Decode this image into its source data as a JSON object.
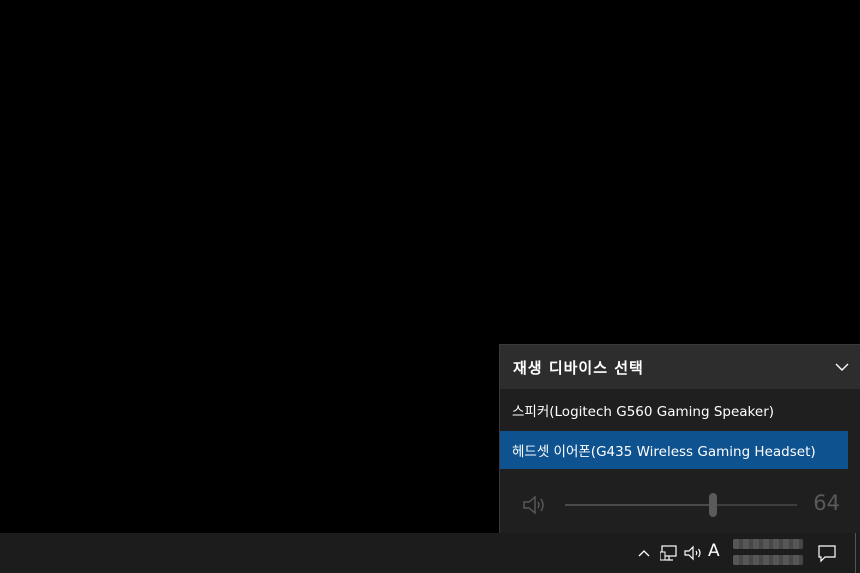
{
  "flyout": {
    "title": "재생 디바이스 선택",
    "devices": [
      {
        "label": "스피커(Logitech G560 Gaming Speaker)",
        "selected": false
      },
      {
        "label": "헤드셋 이어폰(G435 Wireless Gaming Headset)",
        "selected": true
      }
    ],
    "volume": {
      "value": "64",
      "level_percent": 64
    }
  },
  "taskbar": {
    "ime_label": "A"
  },
  "colors": {
    "selected": "#0e5290",
    "header": "#2d2d2d",
    "panel": "#1f1f1f",
    "taskbar": "#1c1c1c"
  },
  "icons": {
    "chevron": "chevron-down-icon",
    "speaker": "speaker-icon",
    "tray_chevron": "chevron-up-icon",
    "network": "network-icon",
    "volume": "volume-icon",
    "notifications": "action-center-icon"
  }
}
